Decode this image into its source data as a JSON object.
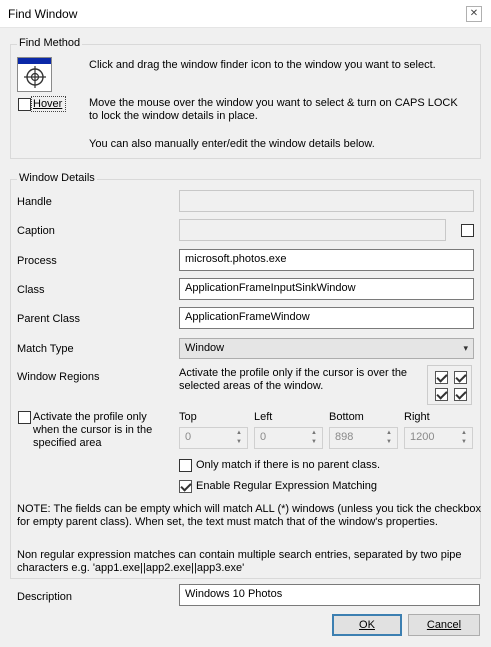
{
  "window": {
    "title": "Find Window",
    "close_glyph": "✕"
  },
  "find_method": {
    "legend": "Find Method",
    "drag_instruction": "Click and drag the window finder icon to the window you want to select.",
    "hover_label": "Hover",
    "hover_checked": false,
    "hover_instruction_line1": "Move the mouse over the window you want to select & turn on CAPS LOCK",
    "hover_instruction_line2": "to lock the window details in place.",
    "manual_instruction": "You can also manually enter/edit the window details below."
  },
  "details": {
    "legend": "Window Details",
    "handle_label": "Handle",
    "handle_value": "",
    "caption_label": "Caption",
    "caption_value": "",
    "caption_checked": false,
    "process_label": "Process",
    "process_value": "microsoft.photos.exe",
    "class_label": "Class",
    "class_value": "ApplicationFrameInputSinkWindow",
    "parent_class_label": "Parent Class",
    "parent_class_value": "ApplicationFrameWindow",
    "match_type_label": "Match Type",
    "match_type_value": "Window",
    "regions_label": "Window Regions",
    "regions_text_line1": "Activate the profile only if the cursor is over the",
    "regions_text_line2": "selected areas of the window.",
    "area_label_line1": "Activate the profile only",
    "area_label_line2": "when the cursor is in the",
    "area_label_line3": "specified area",
    "area_checked": false,
    "top_label": "Top",
    "top_value": "0",
    "left_label": "Left",
    "left_value": "0",
    "bottom_label": "Bottom",
    "bottom_value": "898",
    "right_label": "Right",
    "right_value": "1200",
    "no_parent_label": "Only match if there is no parent class.",
    "no_parent_checked": false,
    "regex_label": "Enable Regular Expression Matching",
    "regex_checked": true,
    "note_line1": "NOTE: The fields can be empty which will match ALL (*) windows (unless you tick the checkbox",
    "note_line2": "for empty parent class). When set, the text must match that of the window's properties.",
    "nonregex_line1": "Non regular expression matches can contain multiple search entries, separated by two pipe",
    "nonregex_line2": "characters e.g. 'app1.exe||app2.exe||app3.exe'"
  },
  "description_label": "Description",
  "description_value": "Windows 10 Photos",
  "ok_label": "OK",
  "cancel_label": "Cancel",
  "icons": {
    "finder": "crosshair-target-icon",
    "chevron": "chevron-down-icon"
  }
}
